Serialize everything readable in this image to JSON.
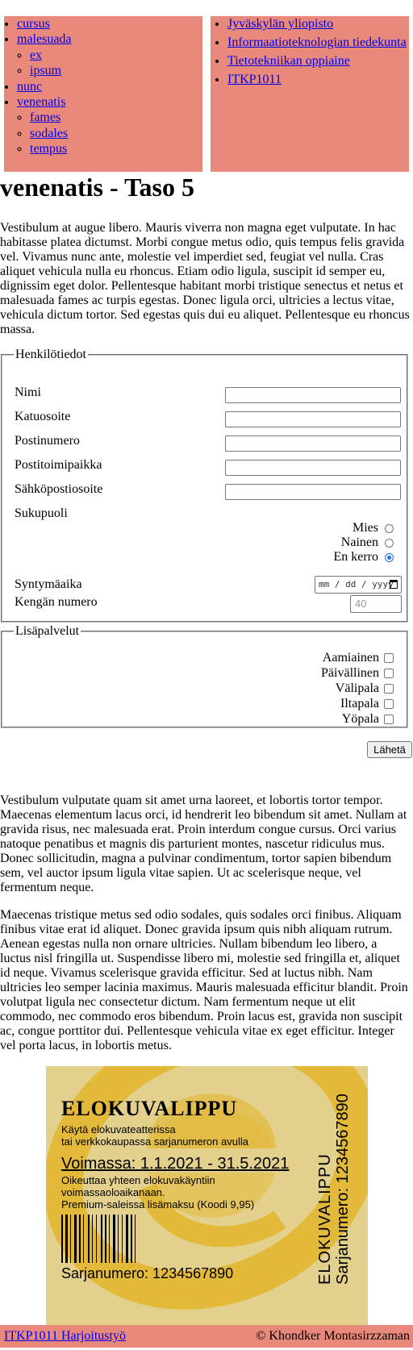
{
  "left_nav": {
    "items": [
      {
        "label": "cursus",
        "children": []
      },
      {
        "label": "malesuada",
        "children": [
          {
            "label": "ex"
          },
          {
            "label": "ipsum"
          }
        ]
      },
      {
        "label": "nunc",
        "children": []
      },
      {
        "label": "venenatis",
        "children": [
          {
            "label": "fames"
          },
          {
            "label": "sodales"
          },
          {
            "label": "tempus"
          }
        ]
      }
    ]
  },
  "right_nav": {
    "items": [
      {
        "label": "Jyväskylän yliopisto"
      },
      {
        "label": "Informaatioteknologian tiedekunta"
      },
      {
        "label": "Tietotekniikan oppiaine"
      },
      {
        "label": "ITKP1011"
      }
    ]
  },
  "page": {
    "title": "venenatis - Taso 5",
    "intro": "Vestibulum at augue libero. Mauris viverra non magna eget vulputate. In hac habitasse platea dictumst. Morbi congue metus odio, quis tempus felis gravida vel. Vivamus nunc ante, molestie vel imperdiet sed, feugiat vel nulla. Cras aliquet vehicula nulla eu rhoncus. Etiam odio ligula, suscipit id semper eu, dignissim eget dolor. Pellentesque habitant morbi tristique senectus et netus et malesuada fames ac turpis egestas. Donec ligula orci, ultricies a lectus vitae, vehicula dictum tortor. Sed egestas quis dui eu aliquet. Pellentesque eu rhoncus massa.",
    "text_2": "Vestibulum vulputate quam sit amet urna laoreet, et lobortis tortor tempor. Maecenas elementum lacus orci, id hendrerit leo bibendum sit amet. Nullam at gravida risus, nec malesuada erat. Proin interdum congue cursus. Orci varius natoque penatibus et magnis dis parturient montes, nascetur ridiculus mus. Donec sollicitudin, magna a pulvinar condimentum, tortor sapien bibendum sem, vel auctor ipsum ligula vitae sapien. Ut ac scelerisque neque, vel fermentum neque.",
    "text_3": "Maecenas tristique metus sed odio sodales, quis sodales orci finibus. Aliquam finibus vitae erat id aliquet. Donec gravida ipsum quis nibh aliquam rutrum. Aenean egestas nulla non ornare ultricies. Nullam bibendum leo libero, a luctus nisl fringilla ut. Suspendisse libero mi, molestie sed fringilla et, aliquet id neque. Vivamus scelerisque gravida efficitur. Sed at luctus nibh. Nam ultricies leo semper lacinia maximus. Mauris malesuada efficitur blandit. Proin volutpat ligula nec consectetur dictum. Nam fermentum neque ut elit commodo, nec commodo eros bibendum. Proin lacus est, gravida non suscipit ac, congue porttitor dui. Pellentesque vehicula vitae ex eget efficitur. Integer vel porta lacus, in lobortis metus."
  },
  "form": {
    "person_legend": "Henkilötiedot",
    "fields": {
      "name": "Nimi",
      "street": "Katuosoite",
      "postcode": "Postinumero",
      "city": "Postitoimipaikka",
      "email": "Sähköpostiosoite",
      "gender": "Sukupuoli",
      "birthdate": "Syntymäaika",
      "shoe": "Kengän numero"
    },
    "gender_options": {
      "male": "Mies",
      "female": "Nainen",
      "none": "En kerro"
    },
    "gender_selected": "En kerro",
    "date_placeholder": "mm / dd / yyyy",
    "shoe_placeholder": "40",
    "extras_legend": "Lisäpalvelut",
    "extras": {
      "breakfast": "Aamiainen",
      "lunch": "Päivällinen",
      "snack": "Välipala",
      "evening": "Iltapala",
      "night": "Yöpala"
    },
    "submit_label": "Lähetä"
  },
  "ticket": {
    "title": "ELOKUVALIPPU",
    "line1": "Käytä elokuvateatterissa",
    "line2": "tai verkkokaupassa sarjanumeron avulla",
    "validity": "Voimassa: 1.1.2021 - 31.5.2021",
    "note1": "Oikeuttaa yhteen elokuvakäyntiin",
    "note2": "voimassaoloaikanaan.",
    "note3": "Premium-saleissa lisämaksu (Koodi 9,95)",
    "serial": "Sarjanumero: 1234567890",
    "side_title": "ELOKUVALIPPU",
    "side_serial": "Sarjanumero: 1234567890",
    "colors": {
      "background": "#e2d08c",
      "logo": "#e3b93a"
    }
  },
  "footer": {
    "link": "ITKP1011 Harjoitustyö",
    "credit": "©  Khondker Montasirzzaman"
  },
  "colors": {
    "nav_background": "#e9897b",
    "link": "#0000ee"
  }
}
